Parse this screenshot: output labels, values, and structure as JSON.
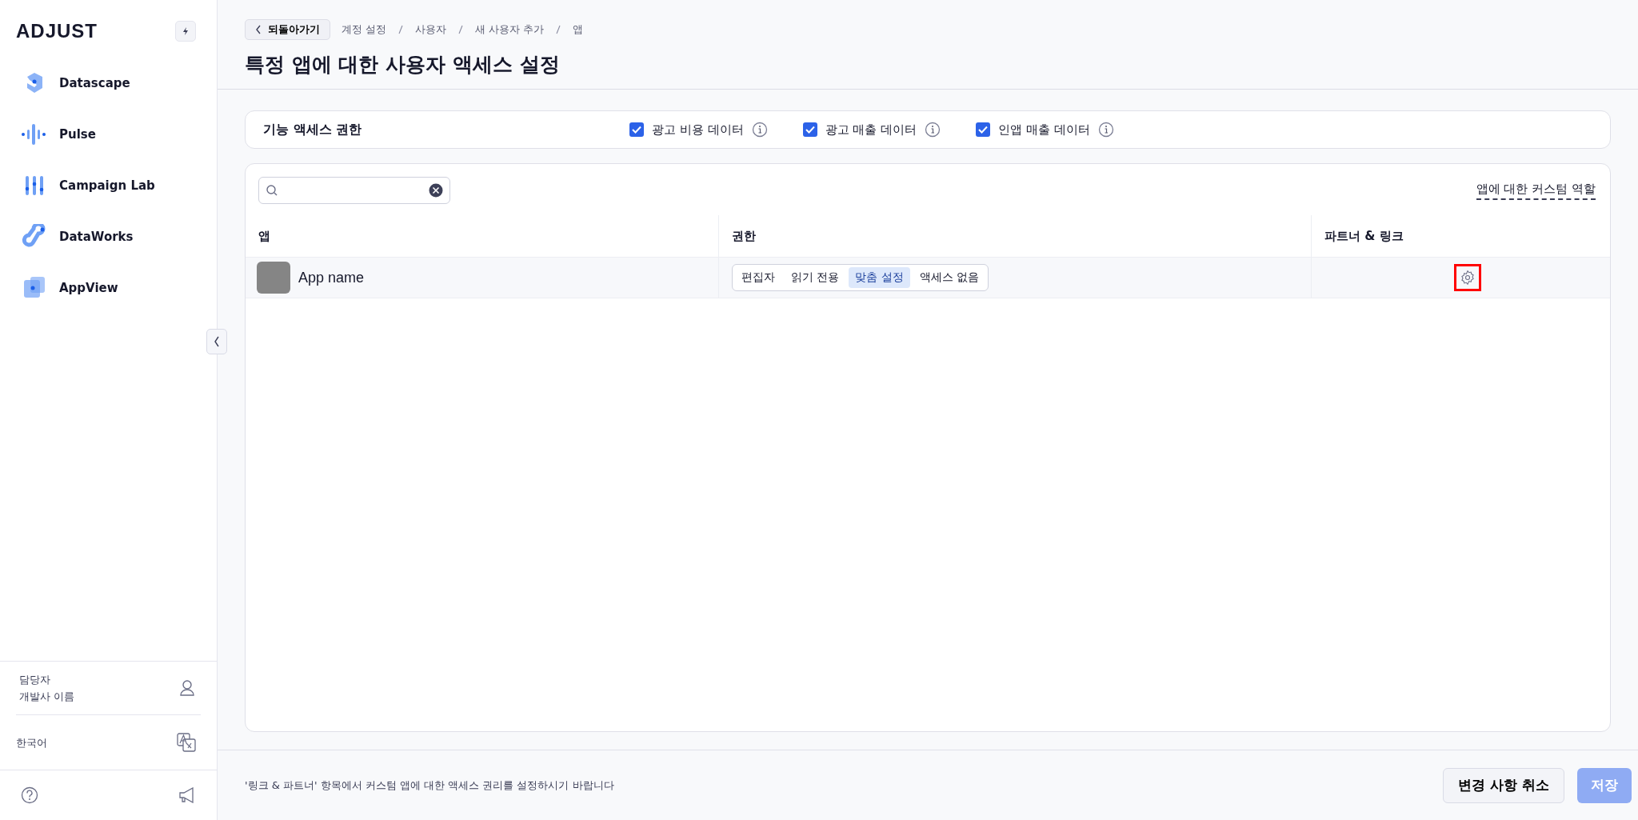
{
  "sidebar": {
    "logo": "ADJUST",
    "items": [
      {
        "label": "Datascape",
        "kind": "datascape"
      },
      {
        "label": "Pulse",
        "kind": "pulse"
      },
      {
        "label": "Campaign Lab",
        "kind": "lab"
      },
      {
        "label": "DataWorks",
        "kind": "dataworks"
      },
      {
        "label": "AppView",
        "kind": "appview"
      }
    ],
    "user": {
      "role": "담당자",
      "name": "개발사 이름"
    },
    "language": "한국어"
  },
  "header": {
    "back_button": "되돌아가기",
    "breadcrumbs": [
      "계정 설정",
      "사용자",
      "새 사용자 추가",
      "앱"
    ],
    "title": "특정 앱에 대한 사용자 액세스 설정"
  },
  "feature_access": {
    "label": "기능 액세스 권한",
    "options": [
      {
        "label": "광고 비용 데이터",
        "checked": true
      },
      {
        "label": "광고 매출 데이터",
        "checked": true
      },
      {
        "label": "인앱 매출 데이터",
        "checked": true
      }
    ]
  },
  "table": {
    "custom_role_link": "앱에 대한 커스텀 역할",
    "columns": [
      "앱",
      "권한",
      "파트너 & 링크"
    ],
    "rows": [
      {
        "app": "App name",
        "permissions": [
          {
            "label": "편집자",
            "selected": false
          },
          {
            "label": "읽기 전용",
            "selected": false
          },
          {
            "label": "맞춤 설정",
            "selected": true
          },
          {
            "label": "액세스 없음",
            "selected": false
          }
        ],
        "settings_highlighted": true
      }
    ]
  },
  "footer": {
    "note": "'링크 & 파트너' 항목에서 커스텀 앱에 대한 액세스 권리를 설정하시기 바랍니다",
    "cancel": "변경 사항 취소",
    "save": {
      "label": "저장",
      "disabled": true
    }
  }
}
